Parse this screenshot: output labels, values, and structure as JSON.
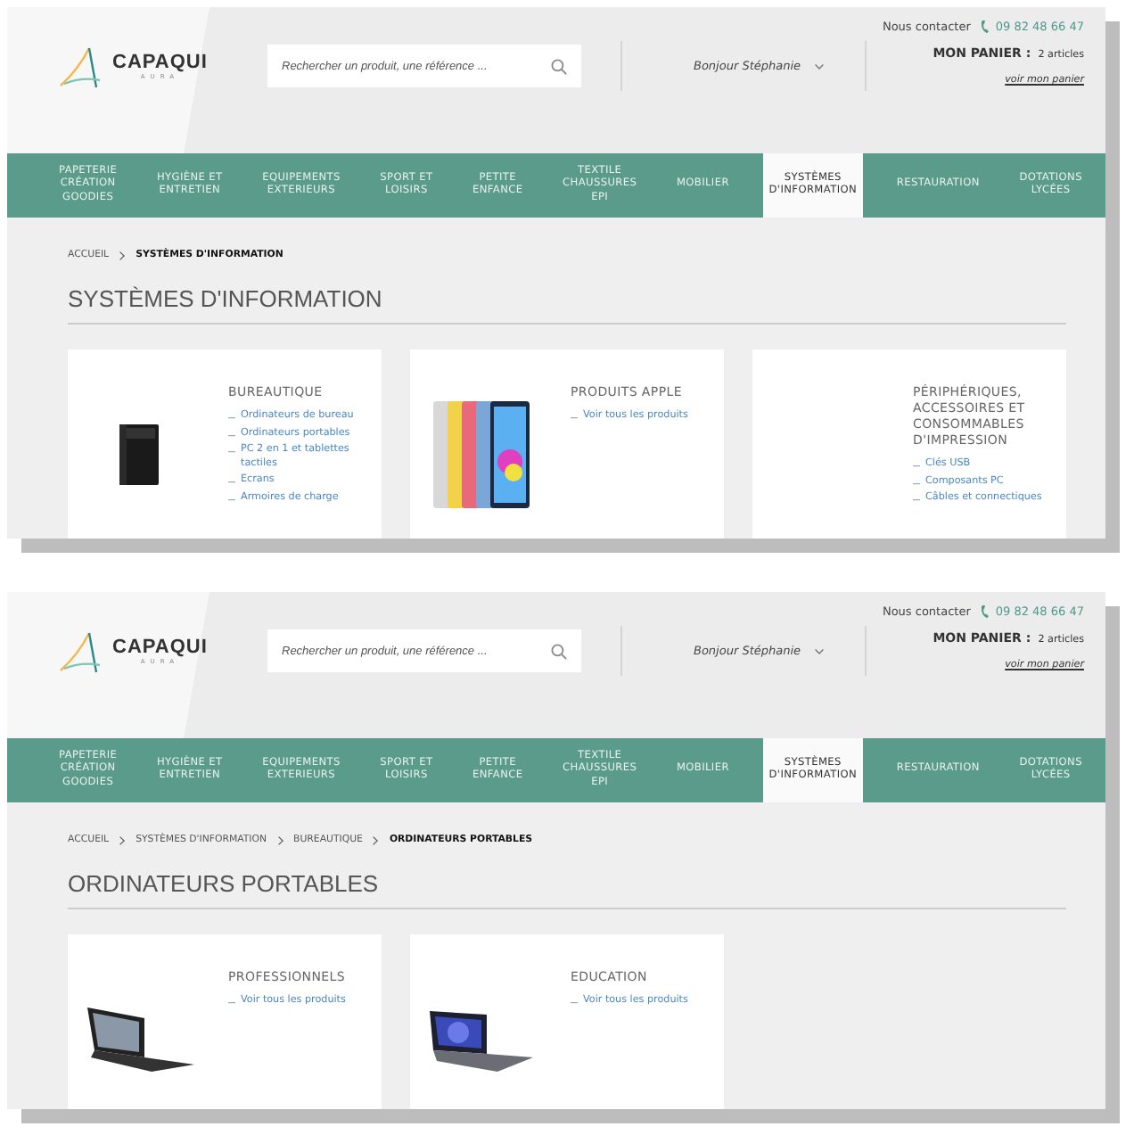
{
  "screens": [
    {
      "contact": {
        "label": "Nous contacter",
        "phone": "09 82 48 66 47"
      },
      "logo": {
        "name": "CAPAQUI",
        "subtitle": "AURA"
      },
      "search": {
        "placeholder": "Rechercher un produit, une référence ..."
      },
      "greeting": "Bonjour Stéphanie",
      "cart": {
        "label": "MON PANIER :",
        "count": "2 articles",
        "link": "voir mon panier"
      },
      "nav": [
        {
          "label": "PAPETERIE\nCRÉATION\nGOODIES",
          "selected": false
        },
        {
          "label": "HYGIÈNE ET\nENTRETIEN",
          "selected": false
        },
        {
          "label": "EQUIPEMENTS\nEXTERIEURS",
          "selected": false
        },
        {
          "label": "SPORT ET\nLOISIRS",
          "selected": false
        },
        {
          "label": "PETITE\nENFANCE",
          "selected": false
        },
        {
          "label": "TEXTILE\nCHAUSSURES\nEPI",
          "selected": false
        },
        {
          "label": "MOBILIER",
          "selected": false
        },
        {
          "label": "SYSTÈMES\nD'INFORMATION",
          "selected": true
        },
        {
          "label": "RESTAURATION",
          "selected": false
        },
        {
          "label": "DOTATIONS\nLYCÉES",
          "selected": false
        }
      ],
      "breadcrumb": [
        {
          "label": "ACCUEIL",
          "current": false
        },
        {
          "label": "SYSTÈMES D'INFORMATION",
          "current": true
        }
      ],
      "title": "SYSTÈMES D'INFORMATION",
      "cards": [
        {
          "kind": "tower",
          "title": "BUREAUTIQUE",
          "links": [
            "Ordinateurs de bureau",
            "Ordinateurs portables",
            "PC 2 en 1 et tablettes tactiles",
            "Ecrans",
            "Armoires de charge"
          ]
        },
        {
          "kind": "tablets",
          "title": "PRODUITS APPLE",
          "links": [
            "Voir tous les produits"
          ]
        },
        {
          "kind": "none",
          "title": "PÉRIPHÉRIQUES, ACCESSOIRES ET CONSOMMABLES D'IMPRESSION",
          "links": [
            "Clés USB",
            "Composants PC",
            "Câbles et connectiques"
          ]
        }
      ]
    },
    {
      "contact": {
        "label": "Nous contacter",
        "phone": "09 82 48 66 47"
      },
      "logo": {
        "name": "CAPAQUI",
        "subtitle": "AURA"
      },
      "search": {
        "placeholder": "Rechercher un produit, une référence ..."
      },
      "greeting": "Bonjour Stéphanie",
      "cart": {
        "label": "MON PANIER :",
        "count": "2 articles",
        "link": "voir mon panier"
      },
      "nav": [
        {
          "label": "PAPETERIE\nCRÉATION\nGOODIES",
          "selected": false
        },
        {
          "label": "HYGIÈNE ET\nENTRETIEN",
          "selected": false
        },
        {
          "label": "EQUIPEMENTS\nEXTERIEURS",
          "selected": false
        },
        {
          "label": "SPORT ET\nLOISIRS",
          "selected": false
        },
        {
          "label": "PETITE\nENFANCE",
          "selected": false
        },
        {
          "label": "TEXTILE\nCHAUSSURES\nEPI",
          "selected": false
        },
        {
          "label": "MOBILIER",
          "selected": false
        },
        {
          "label": "SYSTÈMES\nD'INFORMATION",
          "selected": true
        },
        {
          "label": "RESTAURATION",
          "selected": false
        },
        {
          "label": "DOTATIONS\nLYCÉES",
          "selected": false
        }
      ],
      "breadcrumb": [
        {
          "label": "ACCUEIL",
          "current": false
        },
        {
          "label": "SYSTÈMES D'INFORMATION",
          "current": false
        },
        {
          "label": "BUREAUTIQUE",
          "current": false
        },
        {
          "label": "ORDINATEURS PORTABLES",
          "current": true
        }
      ],
      "title": "ORDINATEURS PORTABLES",
      "cards": [
        {
          "kind": "laptop",
          "title": "PROFESSIONNELS",
          "links": [
            "Voir tous les produits"
          ]
        },
        {
          "kind": "laptop2",
          "title": "EDUCATION",
          "links": [
            "Voir tous les produits"
          ]
        }
      ]
    }
  ]
}
